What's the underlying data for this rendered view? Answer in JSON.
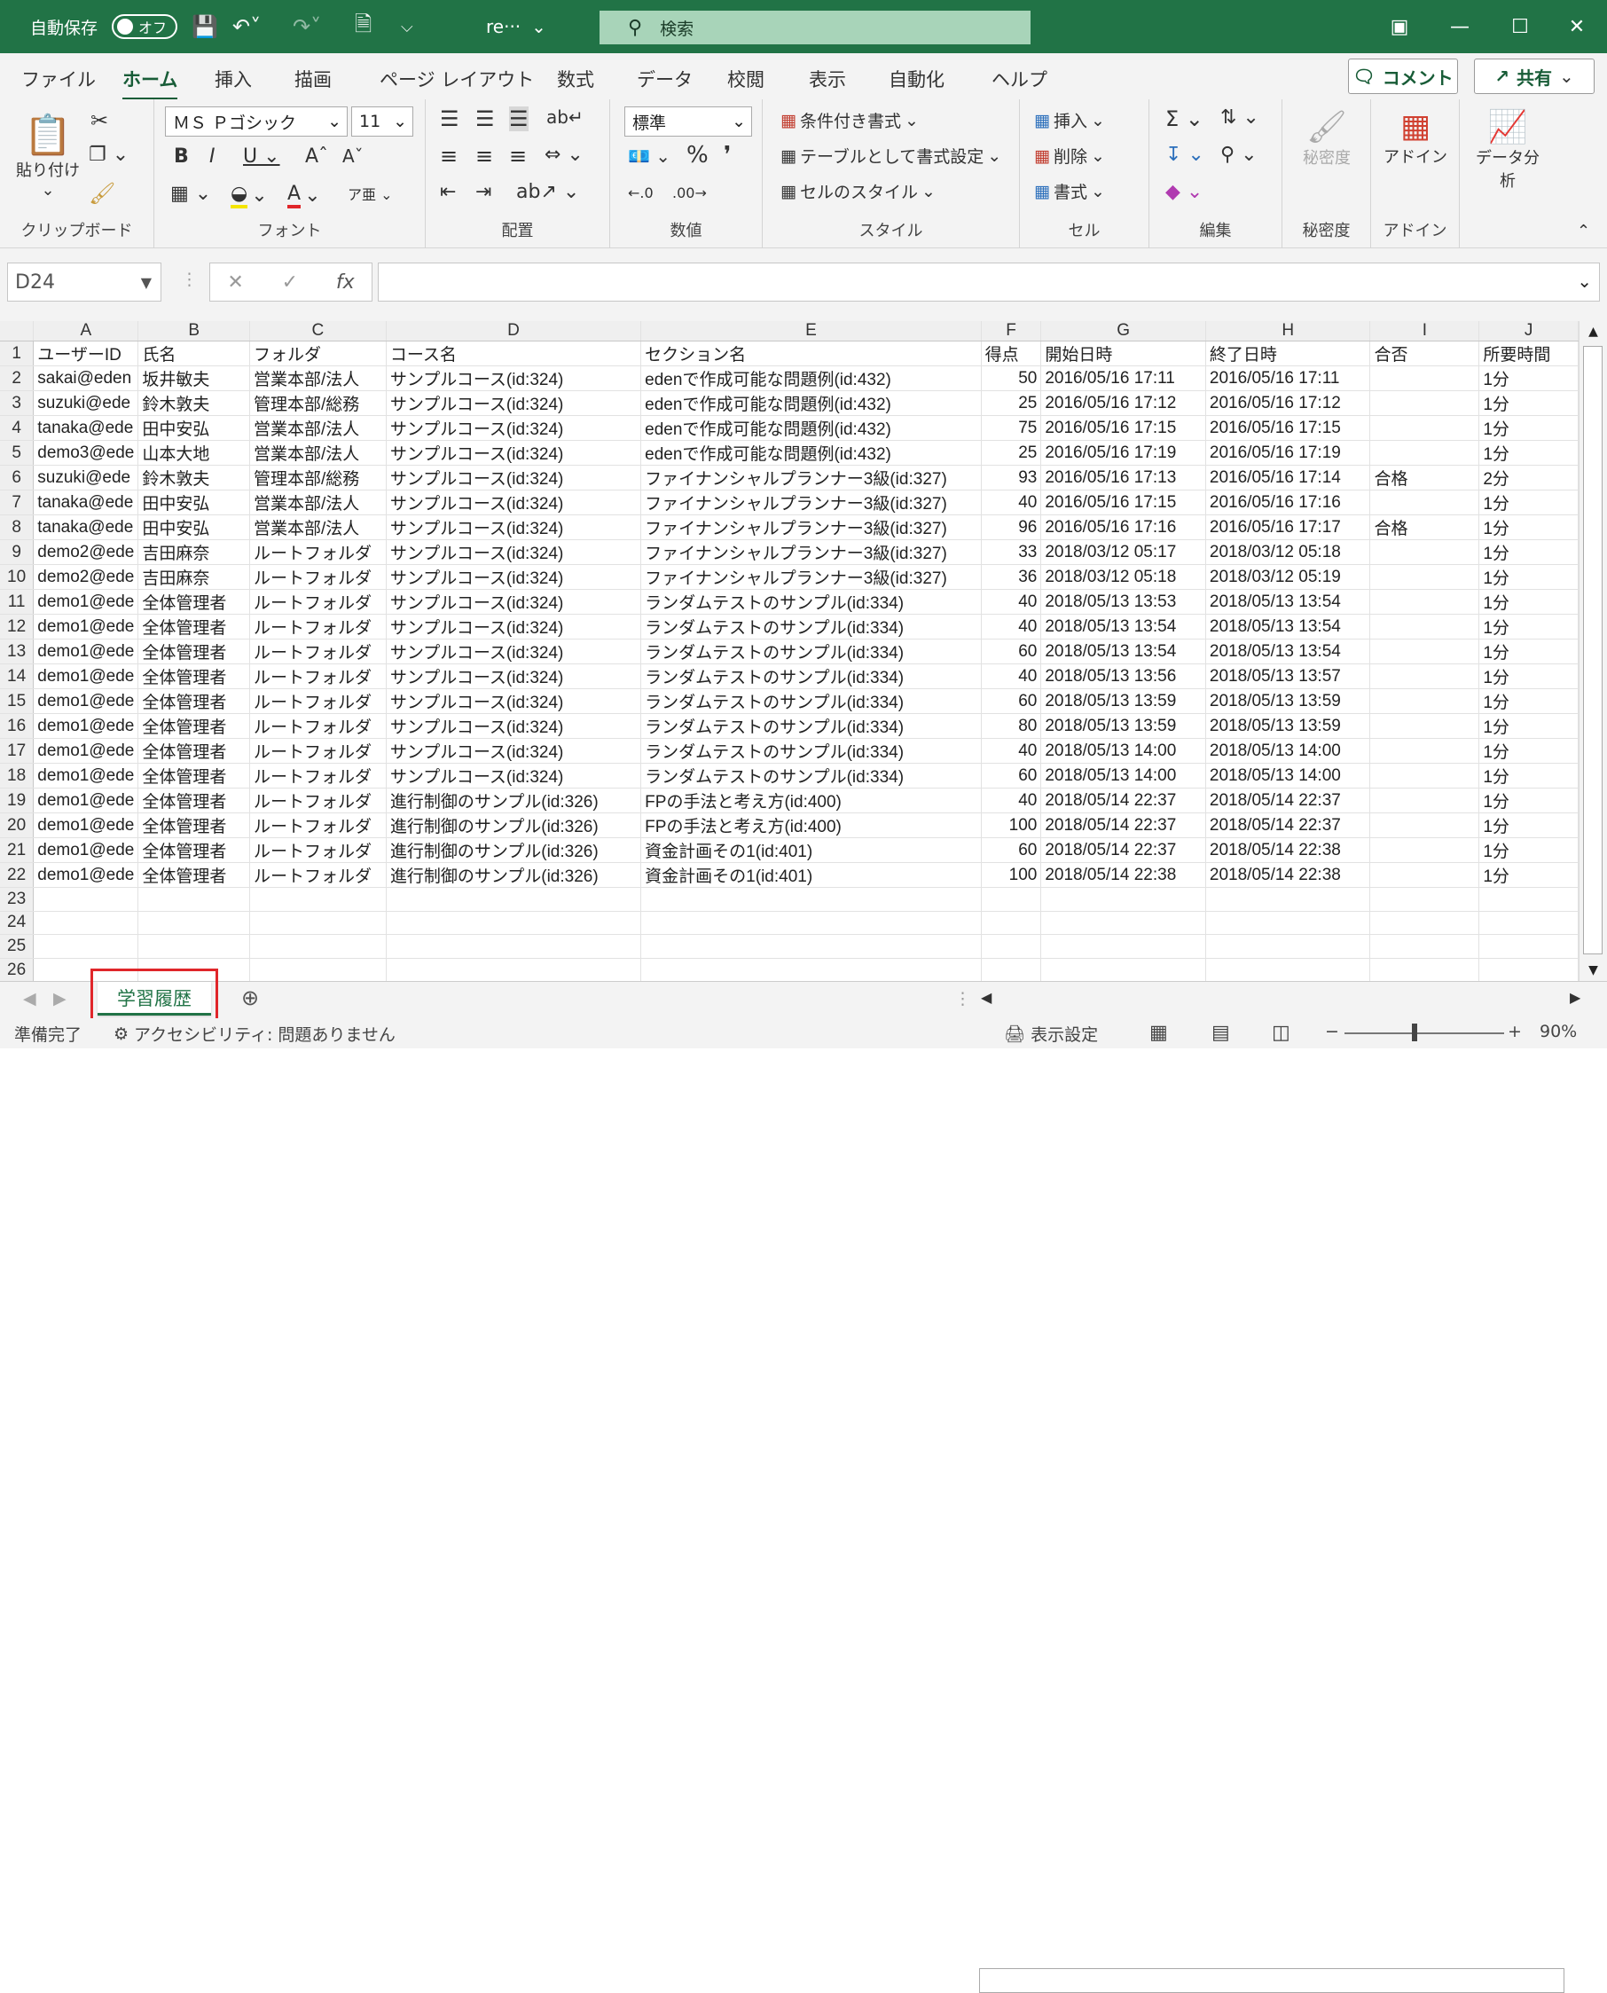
{
  "titlebar": {
    "autosave_label": "自動保存",
    "autosave_state": "オフ",
    "filename": "re···",
    "search_placeholder": "検索"
  },
  "ribbon_tabs": [
    "ファイル",
    "ホーム",
    "挿入",
    "描画",
    "ページ レイアウト",
    "数式",
    "データ",
    "校閲",
    "表示",
    "自動化",
    "ヘルプ"
  ],
  "active_tab": "ホーム",
  "comment_button": "コメント",
  "share_button": "共有",
  "ribbon": {
    "clipboard": {
      "paste": "貼り付け",
      "label": "クリップボード"
    },
    "font": {
      "name": "ＭＳ Ｐゴシック",
      "size": "11",
      "label": "フォント"
    },
    "alignment": {
      "label": "配置"
    },
    "number": {
      "format": "標準",
      "label": "数値"
    },
    "styles": {
      "conditional": "条件付き書式",
      "table": "テーブルとして書式設定",
      "cell": "セルのスタイル",
      "label": "スタイル"
    },
    "cells": {
      "insert": "挿入",
      "delete": "削除",
      "format": "書式",
      "label": "セル"
    },
    "editing": {
      "label": "編集"
    },
    "sensitivity": {
      "button": "秘密度",
      "label": "秘密度"
    },
    "addins": {
      "button": "アドイン",
      "label": "アドイン"
    },
    "analysis": {
      "button": "データ分析"
    }
  },
  "formula_bar": {
    "name_box": "D24",
    "formula": ""
  },
  "columns": [
    "A",
    "B",
    "C",
    "D",
    "E",
    "F",
    "G",
    "H",
    "I",
    "J"
  ],
  "rows": [
    [
      "ユーザーID",
      "氏名",
      "フォルダ",
      "コース名",
      "セクション名",
      "得点",
      "開始日時",
      "終了日時",
      "合否",
      "所要時間"
    ],
    [
      "sakai@eden",
      "坂井敏夫",
      "営業本部/法人",
      "サンプルコース(id:324)",
      "edenで作成可能な問題例(id:432)",
      "50",
      "2016/05/16 17:11",
      "2016/05/16 17:11",
      "",
      "1分"
    ],
    [
      "suzuki@ede",
      "鈴木敦夫",
      "管理本部/総務",
      "サンプルコース(id:324)",
      "edenで作成可能な問題例(id:432)",
      "25",
      "2016/05/16 17:12",
      "2016/05/16 17:12",
      "",
      "1分"
    ],
    [
      "tanaka@ede",
      "田中安弘",
      "営業本部/法人",
      "サンプルコース(id:324)",
      "edenで作成可能な問題例(id:432)",
      "75",
      "2016/05/16 17:15",
      "2016/05/16 17:15",
      "",
      "1分"
    ],
    [
      "demo3@ede",
      "山本大地",
      "営業本部/法人",
      "サンプルコース(id:324)",
      "edenで作成可能な問題例(id:432)",
      "25",
      "2016/05/16 17:19",
      "2016/05/16 17:19",
      "",
      "1分"
    ],
    [
      "suzuki@ede",
      "鈴木敦夫",
      "管理本部/総務",
      "サンプルコース(id:324)",
      "ファイナンシャルプランナー3級(id:327)",
      "93",
      "2016/05/16 17:13",
      "2016/05/16 17:14",
      "合格",
      "2分"
    ],
    [
      "tanaka@ede",
      "田中安弘",
      "営業本部/法人",
      "サンプルコース(id:324)",
      "ファイナンシャルプランナー3級(id:327)",
      "40",
      "2016/05/16 17:15",
      "2016/05/16 17:16",
      "",
      "1分"
    ],
    [
      "tanaka@ede",
      "田中安弘",
      "営業本部/法人",
      "サンプルコース(id:324)",
      "ファイナンシャルプランナー3級(id:327)",
      "96",
      "2016/05/16 17:16",
      "2016/05/16 17:17",
      "合格",
      "1分"
    ],
    [
      "demo2@ede",
      "吉田麻奈",
      "ルートフォルダ",
      "サンプルコース(id:324)",
      "ファイナンシャルプランナー3級(id:327)",
      "33",
      "2018/03/12 05:17",
      "2018/03/12 05:18",
      "",
      "1分"
    ],
    [
      "demo2@ede",
      "吉田麻奈",
      "ルートフォルダ",
      "サンプルコース(id:324)",
      "ファイナンシャルプランナー3級(id:327)",
      "36",
      "2018/03/12 05:18",
      "2018/03/12 05:19",
      "",
      "1分"
    ],
    [
      "demo1@ede",
      "全体管理者",
      "ルートフォルダ",
      "サンプルコース(id:324)",
      "ランダムテストのサンプル(id:334)",
      "40",
      "2018/05/13 13:53",
      "2018/05/13 13:54",
      "",
      "1分"
    ],
    [
      "demo1@ede",
      "全体管理者",
      "ルートフォルダ",
      "サンプルコース(id:324)",
      "ランダムテストのサンプル(id:334)",
      "40",
      "2018/05/13 13:54",
      "2018/05/13 13:54",
      "",
      "1分"
    ],
    [
      "demo1@ede",
      "全体管理者",
      "ルートフォルダ",
      "サンプルコース(id:324)",
      "ランダムテストのサンプル(id:334)",
      "60",
      "2018/05/13 13:54",
      "2018/05/13 13:54",
      "",
      "1分"
    ],
    [
      "demo1@ede",
      "全体管理者",
      "ルートフォルダ",
      "サンプルコース(id:324)",
      "ランダムテストのサンプル(id:334)",
      "40",
      "2018/05/13 13:56",
      "2018/05/13 13:57",
      "",
      "1分"
    ],
    [
      "demo1@ede",
      "全体管理者",
      "ルートフォルダ",
      "サンプルコース(id:324)",
      "ランダムテストのサンプル(id:334)",
      "60",
      "2018/05/13 13:59",
      "2018/05/13 13:59",
      "",
      "1分"
    ],
    [
      "demo1@ede",
      "全体管理者",
      "ルートフォルダ",
      "サンプルコース(id:324)",
      "ランダムテストのサンプル(id:334)",
      "80",
      "2018/05/13 13:59",
      "2018/05/13 13:59",
      "",
      "1分"
    ],
    [
      "demo1@ede",
      "全体管理者",
      "ルートフォルダ",
      "サンプルコース(id:324)",
      "ランダムテストのサンプル(id:334)",
      "40",
      "2018/05/13 14:00",
      "2018/05/13 14:00",
      "",
      "1分"
    ],
    [
      "demo1@ede",
      "全体管理者",
      "ルートフォルダ",
      "サンプルコース(id:324)",
      "ランダムテストのサンプル(id:334)",
      "60",
      "2018/05/13 14:00",
      "2018/05/13 14:00",
      "",
      "1分"
    ],
    [
      "demo1@ede",
      "全体管理者",
      "ルートフォルダ",
      "進行制御のサンプル(id:326)",
      "FPの手法と考え方(id:400)",
      "40",
      "2018/05/14 22:37",
      "2018/05/14 22:37",
      "",
      "1分"
    ],
    [
      "demo1@ede",
      "全体管理者",
      "ルートフォルダ",
      "進行制御のサンプル(id:326)",
      "FPの手法と考え方(id:400)",
      "100",
      "2018/05/14 22:37",
      "2018/05/14 22:37",
      "",
      "1分"
    ],
    [
      "demo1@ede",
      "全体管理者",
      "ルートフォルダ",
      "進行制御のサンプル(id:326)",
      "資金計画その1(id:401)",
      "60",
      "2018/05/14 22:37",
      "2018/05/14 22:38",
      "",
      "1分"
    ],
    [
      "demo1@ede",
      "全体管理者",
      "ルートフォルダ",
      "進行制御のサンプル(id:326)",
      "資金計画その1(id:401)",
      "100",
      "2018/05/14 22:38",
      "2018/05/14 22:38",
      "",
      "1分"
    ],
    [
      "",
      "",
      "",
      "",
      "",
      "",
      "",
      "",
      "",
      ""
    ],
    [
      "",
      "",
      "",
      "",
      "",
      "",
      "",
      "",
      "",
      ""
    ],
    [
      "",
      "",
      "",
      "",
      "",
      "",
      "",
      "",
      "",
      ""
    ],
    [
      "",
      "",
      "",
      "",
      "",
      "",
      "",
      "",
      "",
      ""
    ],
    [
      "",
      "",
      "",
      "",
      "",
      "",
      "",
      "",
      "",
      ""
    ]
  ],
  "sheet_tab": "学習履歴",
  "status": {
    "ready": "準備完了",
    "accessibility": "アクセシビリティ: 問題ありません",
    "display_settings": "表示設定",
    "zoom": "90%"
  },
  "colors": {
    "excel_green": "#217346",
    "highlight_red": "#e0262a"
  }
}
